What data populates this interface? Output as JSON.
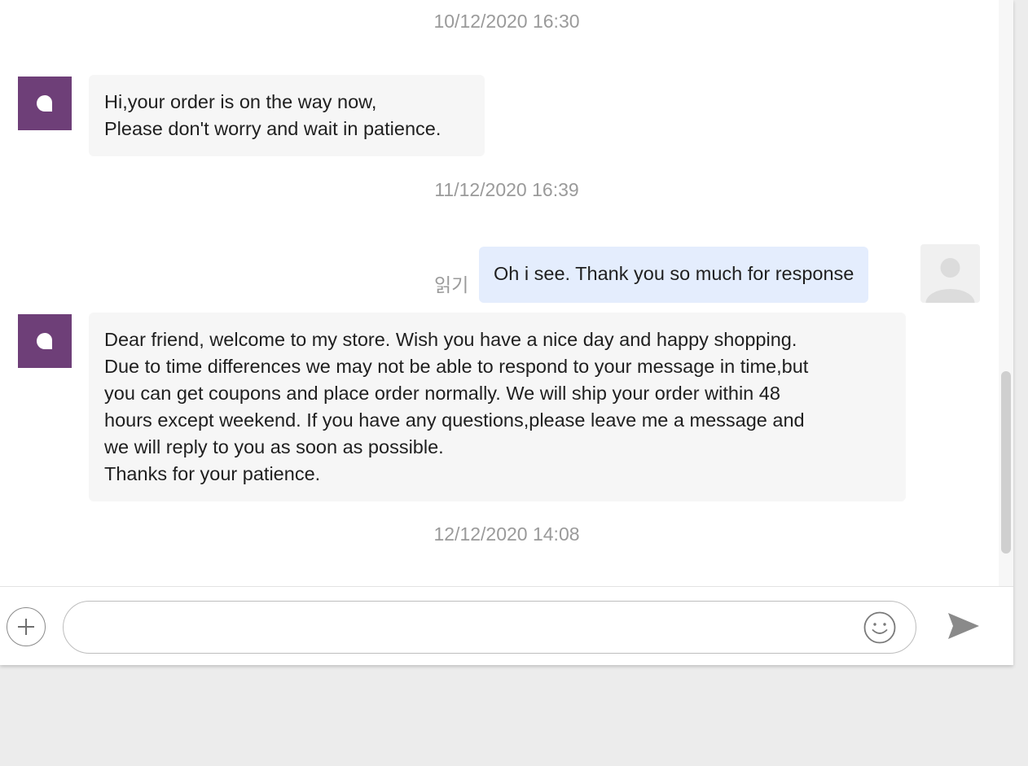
{
  "colors": {
    "store_avatar": "#6e3f78",
    "incoming_bubble": "#f6f6f6",
    "outgoing_bubble": "#e4edfd",
    "timestamp_text": "#9a9a9a",
    "page_background": "#ececec"
  },
  "messages": [
    {
      "kind": "timestamp",
      "text": "10/12/2020 16:30"
    },
    {
      "kind": "incoming",
      "avatar_icon": "store-logo-icon",
      "lines": [
        "Hi,your order is on the way now,",
        "Please don't worry and wait in patience."
      ]
    },
    {
      "kind": "timestamp",
      "text": "11/12/2020 16:39"
    },
    {
      "kind": "outgoing",
      "status": "읽기",
      "text": "Oh i see. Thank you so much for response",
      "avatar_icon": "default-user-avatar-icon"
    },
    {
      "kind": "incoming",
      "avatar_icon": "store-logo-icon",
      "lines": [
        "Dear friend, welcome to my store. Wish you have a nice day and happy shopping.",
        "Due to time differences we may not be able to respond to your message in time,but",
        "you can get coupons and place order normally. We will ship your order within 48",
        "hours except weekend. If you have any questions,please leave me a message and",
        "we will reply to you as soon as possible.",
        "Thanks for your patience."
      ]
    },
    {
      "kind": "timestamp",
      "text": "12/12/2020 14:08"
    }
  ],
  "composer": {
    "attach_icon": "plus-icon",
    "input_value": "",
    "input_placeholder": "",
    "emoji_icon": "smiley-icon",
    "send_icon": "send-arrow-icon"
  }
}
